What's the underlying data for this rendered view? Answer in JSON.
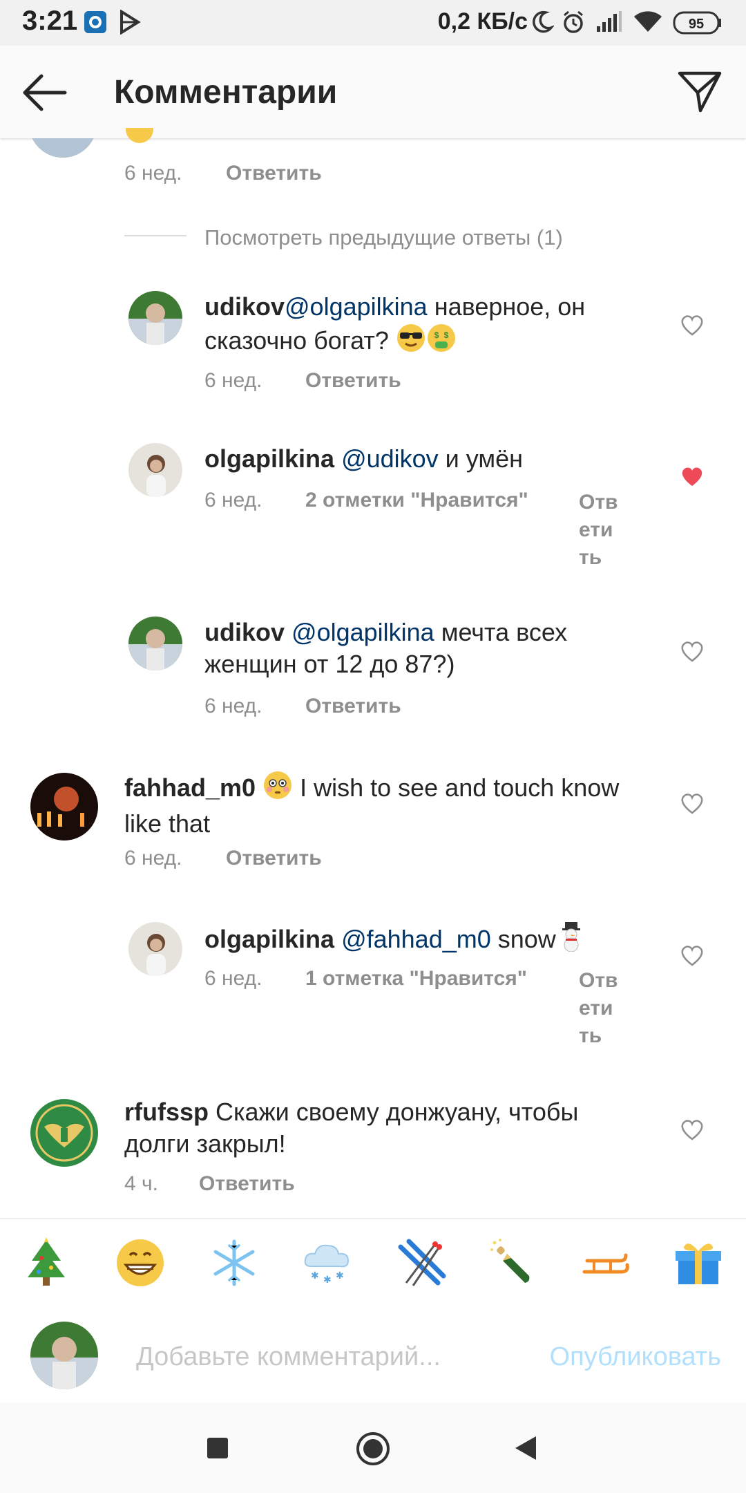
{
  "status_bar": {
    "time": "3:21",
    "network_speed": "0,2 КБ/с",
    "battery": "95"
  },
  "header": {
    "title": "Комментарии",
    "back_icon": "arrow-left-icon",
    "share_icon": "paper-plane-icon"
  },
  "top_comment_meta": {
    "time": "6 нед.",
    "reply": "Ответить"
  },
  "view_previous": "Посмотреть предыдущие ответы (1)",
  "comments": [
    {
      "user": "udikov",
      "mention": "@olgapilkina",
      "text": " наверное, он сказочно богат? ",
      "emojis": [
        "😎",
        "🤑"
      ],
      "time": "6 нед.",
      "reply": "Ответить",
      "liked": false
    },
    {
      "user": "olgapilkina",
      "mention": "@udikov",
      "text": " и умён",
      "time": "6 нед.",
      "likes": "2 отметки \"Нравится\"",
      "reply_lines": [
        "Отв",
        "ети",
        "ть"
      ],
      "liked": true
    },
    {
      "user": "udikov",
      "mention": "@olgapilkina",
      "text_line1": " мечта всех",
      "text_line2": "женщин от 12 до 87?)",
      "time": "6 нед.",
      "reply": "Ответить",
      "liked": false
    },
    {
      "user": "fahhad_m0",
      "emoji": "😳",
      "text_line1": " I wish to see and touch know",
      "text_line2": "like that",
      "time": "6 нед.",
      "reply": "Ответить",
      "liked": false
    },
    {
      "user": "olgapilkina",
      "mention": "@fahhad_m0",
      "text": " snow",
      "emoji": "⛄",
      "time": "6 нед.",
      "likes": "1 отметка \"Нравится\"",
      "reply_lines": [
        "Отв",
        "ети",
        "ть"
      ],
      "liked": false
    },
    {
      "user": "rfufssp",
      "text_line1": " Скажи своему донжуану, чтобы",
      "text_line2": "долги закрыл!",
      "time": "4 ч.",
      "reply": "Ответить",
      "liked": false
    }
  ],
  "emoji_tray": [
    "🎄",
    "😁",
    "❄️",
    "🌨️",
    "🎿",
    "🍾",
    "🛷",
    "🎁"
  ],
  "composer": {
    "placeholder": "Добавьте комментарий...",
    "publish": "Опубликовать"
  },
  "colors": {
    "like_red": "#ed4956",
    "mention_blue": "#003569",
    "publish_disabled": "#b2dffc",
    "meta_gray": "#8e8e8e"
  }
}
